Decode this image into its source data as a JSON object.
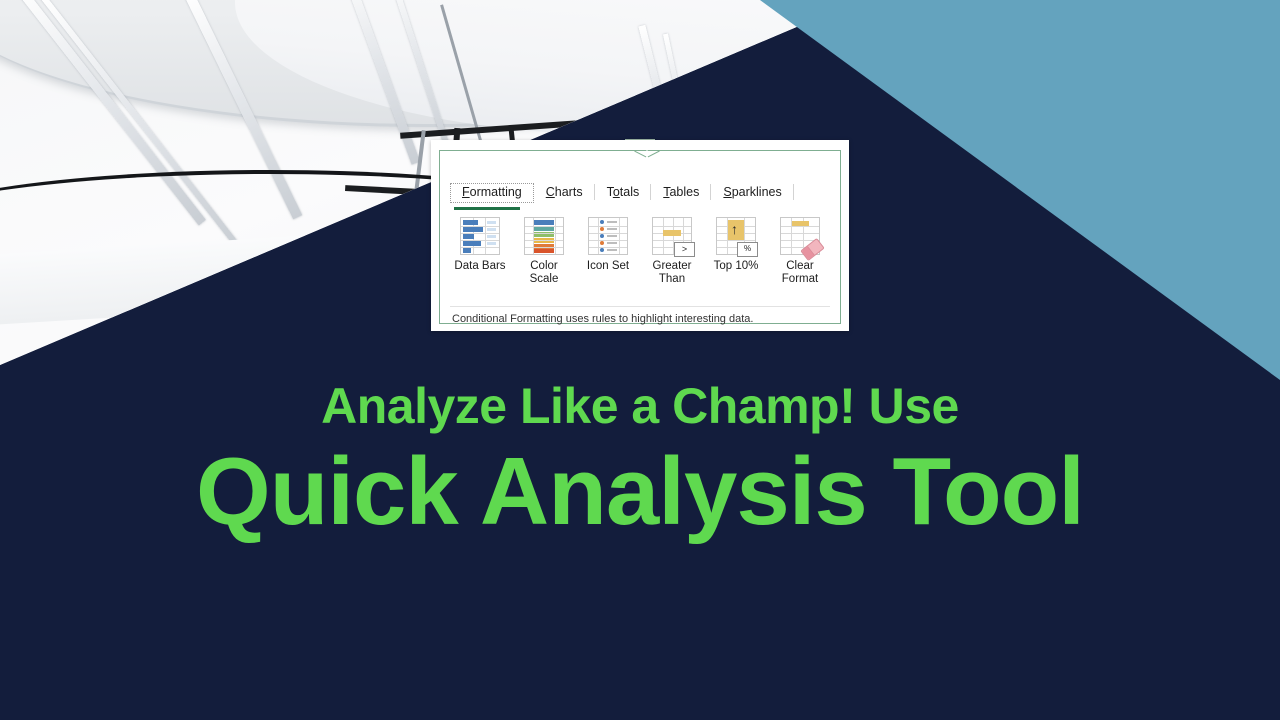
{
  "theme": {
    "navy": "#131D3C",
    "teal": "#64A3BE",
    "green_text": "#5FD94F",
    "panel_border_green": "#7FAE91",
    "tab_underline_green": "#1E7145"
  },
  "background": {
    "photo_alt": "black-and-white architectural canopy with metal trusses",
    "navy_shape": "navy-triangle",
    "teal_shape": "teal-triangle"
  },
  "quick_analysis": {
    "launcher_title": "Quick Analysis",
    "tabs": [
      {
        "label": "Formatting",
        "accel_before": "F",
        "accel_rest": "ormatting",
        "active": true
      },
      {
        "label": "Charts",
        "accel_before": "C",
        "accel_rest": "harts",
        "active": false
      },
      {
        "label": "Totals",
        "accel_before": "T",
        "accel_rest": "otals",
        "active": false
      },
      {
        "label": "Tables",
        "accel_before": "T",
        "accel_rest": "ables",
        "active": false
      },
      {
        "label": "Sparklines",
        "accel_before": "S",
        "accel_rest": "parklines",
        "active": false
      }
    ],
    "gallery": [
      {
        "label": "Data Bars",
        "icon": "data-bars-icon"
      },
      {
        "label": "Color\nScale",
        "label_line1": "Color",
        "label_line2": "Scale",
        "icon": "color-scale-icon"
      },
      {
        "label": "Icon Set",
        "icon": "icon-set-icon"
      },
      {
        "label": "Greater\nThan",
        "label_line1": "Greater",
        "label_line2": "Than",
        "icon": "greater-than-icon",
        "badge": ">"
      },
      {
        "label": "Top 10%",
        "icon": "top-ten-percent-icon",
        "badge": "%"
      },
      {
        "label": "Clear\nFormat",
        "label_line1": "Clear",
        "label_line2": "Format",
        "icon": "clear-format-icon"
      }
    ],
    "tip": "Conditional Formatting uses rules to highlight interesting data."
  },
  "headline": {
    "line1": "Analyze Like a Champ! Use",
    "line2": "Quick Analysis Tool"
  }
}
